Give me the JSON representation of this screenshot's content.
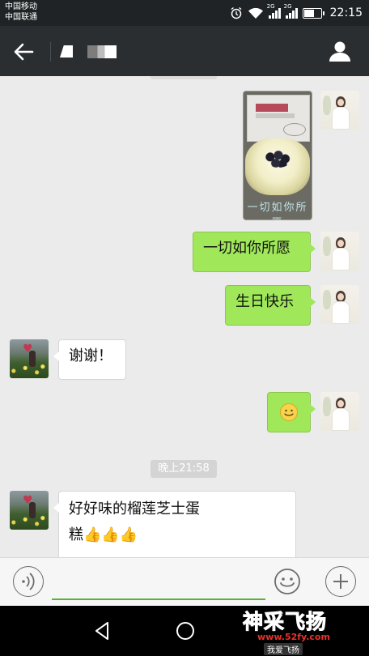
{
  "status_bar": {
    "carrier_1": "中国移动",
    "carrier_2": "中国联通",
    "network_1": "2G",
    "network_2": "2G",
    "time": "22:15",
    "battery_level": 0.7
  },
  "header": {
    "back_icon": "arrow-left-icon",
    "contact_icon": "person-icon"
  },
  "messages": [
    {
      "side": "out",
      "type": "image",
      "caption": "一切如你所愿"
    },
    {
      "side": "out",
      "type": "text",
      "text": "一切如你所愿"
    },
    {
      "side": "out",
      "type": "text",
      "text": "生日快乐"
    },
    {
      "side": "in",
      "type": "text",
      "text": "谢谢！"
    },
    {
      "side": "out",
      "type": "emoji",
      "text": "smile-emoji"
    },
    {
      "side": "in",
      "type": "text",
      "text_line1": "好好味的榴莲芝士蛋",
      "text_line2": "糕",
      "thumbs": "👍👍👍"
    }
  ],
  "timestamp": "晚上21:58",
  "input_bar": {
    "voice_icon": "voice-icon",
    "emoji_icon": "smile-icon",
    "add_icon": "plus-icon",
    "input_value": ""
  },
  "watermark": {
    "title": "神采飞扬",
    "url": "www.52fy.com",
    "sub": "我爱飞扬"
  },
  "colors": {
    "outgoing_bubble": "#a0e75a",
    "incoming_bubble": "#ffffff",
    "chat_background": "#ebebeb",
    "header": "#2a2e31"
  }
}
